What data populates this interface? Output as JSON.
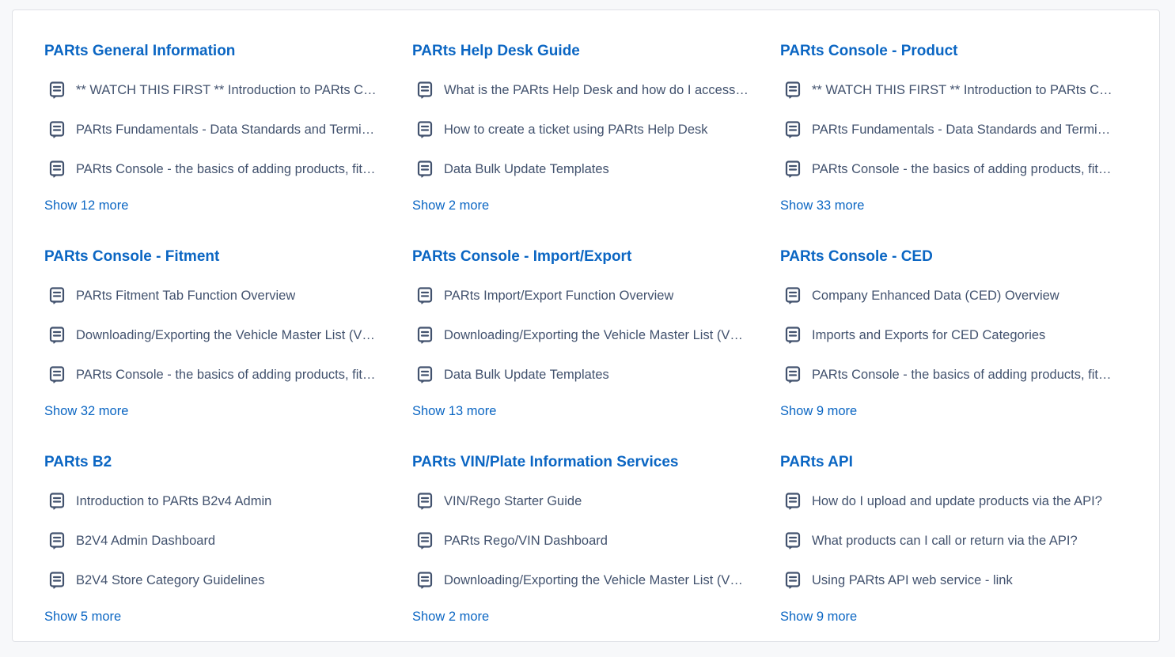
{
  "sections": [
    {
      "title": "PARts General Information",
      "articles": [
        "** WATCH THIS FIRST ** Introduction to PARts Console",
        "PARts Fundamentals - Data Standards and Terminology",
        "PARts Console - the basics of adding products, fitment and CED"
      ],
      "show_more": "Show 12 more"
    },
    {
      "title": "PARts Help Desk Guide",
      "articles": [
        "What is the PARts Help Desk and how do I access it?",
        "How to create a ticket using PARts Help Desk",
        "Data Bulk Update Templates"
      ],
      "show_more": "Show 2 more"
    },
    {
      "title": "PARts Console - Product",
      "articles": [
        "** WATCH THIS FIRST ** Introduction to PARts Console",
        "PARts Fundamentals - Data Standards and Terminology",
        "PARts Console - the basics of adding products, fitment and CED"
      ],
      "show_more": "Show 33 more"
    },
    {
      "title": "PARts Console - Fitment",
      "articles": [
        "PARts Fitment Tab Function Overview",
        "Downloading/Exporting the Vehicle Master List (VML)",
        "PARts Console - the basics of adding products, fitment and CED"
      ],
      "show_more": "Show 32 more"
    },
    {
      "title": "PARts Console - Import/Export",
      "articles": [
        "PARts Import/Export Function Overview",
        "Downloading/Exporting the Vehicle Master List (VML)",
        "Data Bulk Update Templates"
      ],
      "show_more": "Show 13 more"
    },
    {
      "title": "PARts Console - CED",
      "articles": [
        "Company Enhanced Data (CED) Overview",
        "Imports and Exports for CED Categories",
        "PARts Console - the basics of adding products, fitment and CED"
      ],
      "show_more": "Show 9 more"
    },
    {
      "title": "PARts B2",
      "articles": [
        "Introduction to PARts B2v4 Admin",
        "B2V4 Admin Dashboard",
        "B2V4 Store Category Guidelines"
      ],
      "show_more": "Show 5 more"
    },
    {
      "title": "PARts VIN/Plate Information Services",
      "articles": [
        "VIN/Rego Starter Guide",
        "PARts Rego/VIN Dashboard",
        "Downloading/Exporting the Vehicle Master List (VML)"
      ],
      "show_more": "Show 2 more"
    },
    {
      "title": "PARts API",
      "articles": [
        "How do I upload and update products via the API?",
        "What products can I call or return via the API?",
        "Using PARts API web service - link"
      ],
      "show_more": "Show 9 more"
    }
  ],
  "icons": {
    "article": "article-icon"
  },
  "colors": {
    "link": "#0b66c3",
    "text": "#42526e",
    "icon": "#42526e",
    "border": "#dfe1e6"
  }
}
